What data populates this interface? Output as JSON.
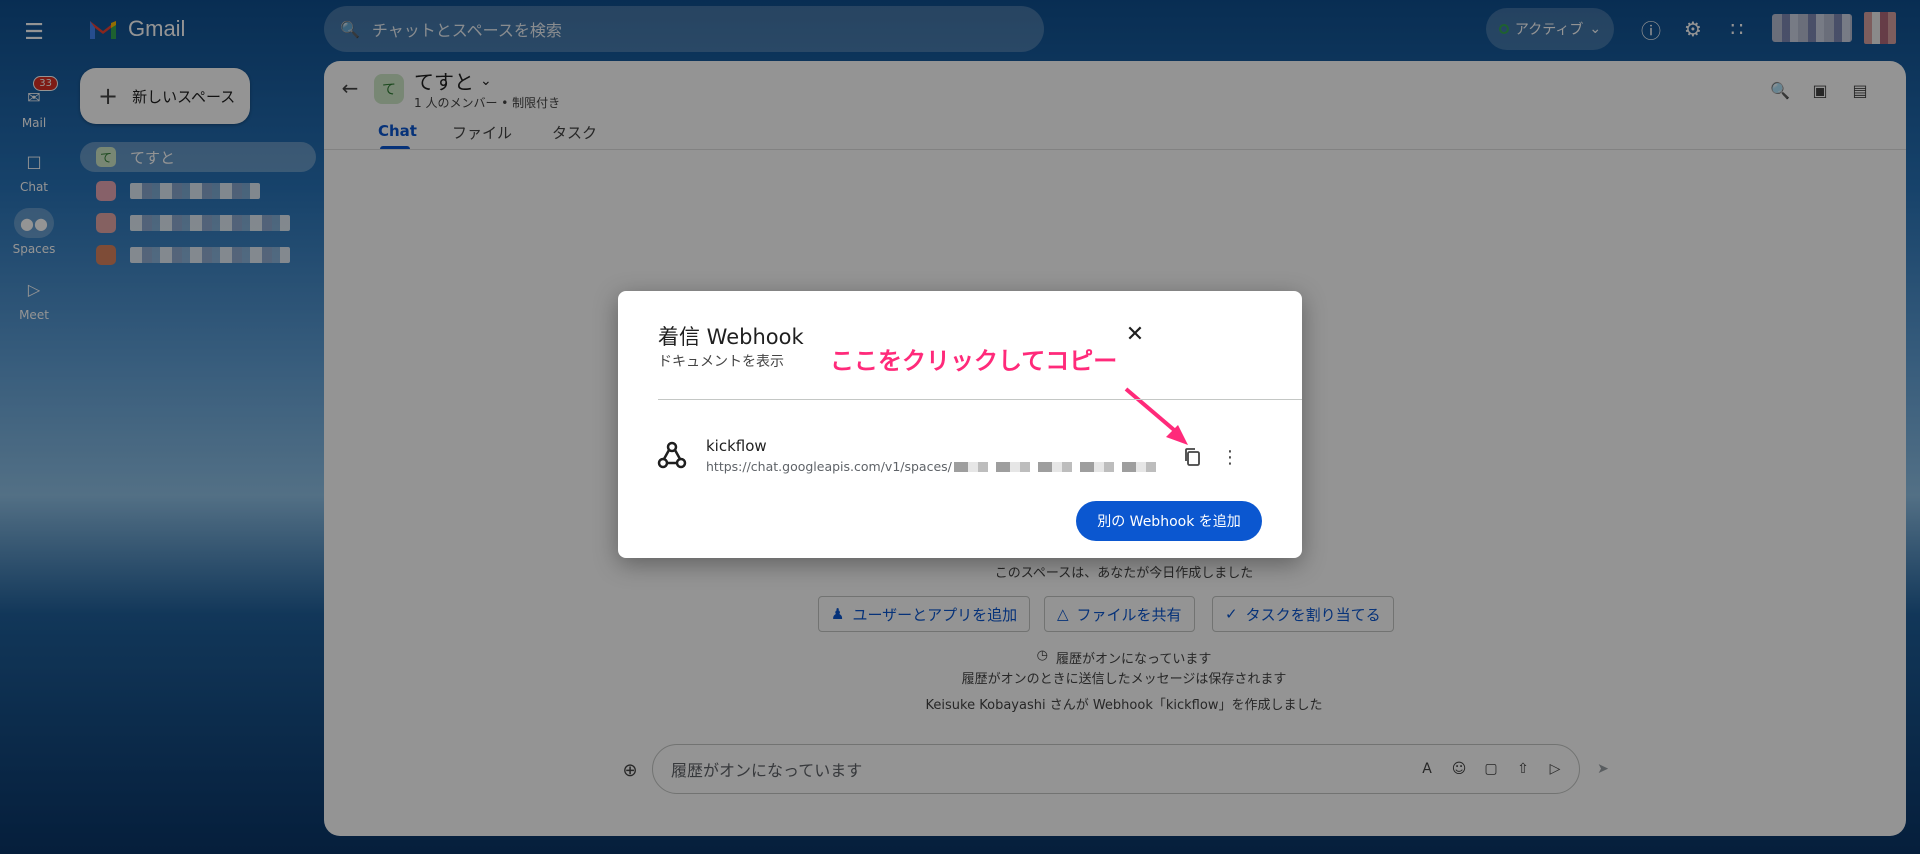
{
  "app": {
    "brand": "Gmail"
  },
  "search": {
    "placeholder": "チャットとスペースを検索"
  },
  "status": {
    "label": "アクティブ"
  },
  "rail": [
    {
      "label": "Mail",
      "badge": "33"
    },
    {
      "label": "Chat"
    },
    {
      "label": "Spaces"
    },
    {
      "label": "Meet"
    }
  ],
  "nav": {
    "new_space": "新しいスペース",
    "active_space": {
      "initial": "て",
      "name": "てすと"
    }
  },
  "room": {
    "initial": "て",
    "name": "てすと",
    "subtitle": "1 人のメンバー • 制限付き",
    "tabs": [
      "Chat",
      "ファイル",
      "タスク"
    ]
  },
  "conversation": {
    "created": "このスペースは、あなたが今日作成しました",
    "actions": [
      "ユーザーとアプリを追加",
      "ファイルを共有",
      "タスクを割り当てる"
    ],
    "history_on": "履歴がオンになっています",
    "history_note": "履歴がオンのときに送信したメッセージは保存されます",
    "webhook_event": "Keisuke Kobayashi さんが Webhook「kickflow」を作成しました"
  },
  "composer": {
    "placeholder": "履歴がオンになっています"
  },
  "modal": {
    "title": "着信 Webhook",
    "doc_link": "ドキュメントを表示",
    "annotation": "ここをクリックしてコピー",
    "webhook": {
      "name": "kickflow",
      "url_prefix": "https://chat.googleapis.com/v1/spaces/"
    },
    "add_button": "別の Webhook を追加"
  },
  "colors": {
    "accent": "#0b57d0",
    "annotation": "#ff2a7a",
    "badge": "#d93025"
  }
}
